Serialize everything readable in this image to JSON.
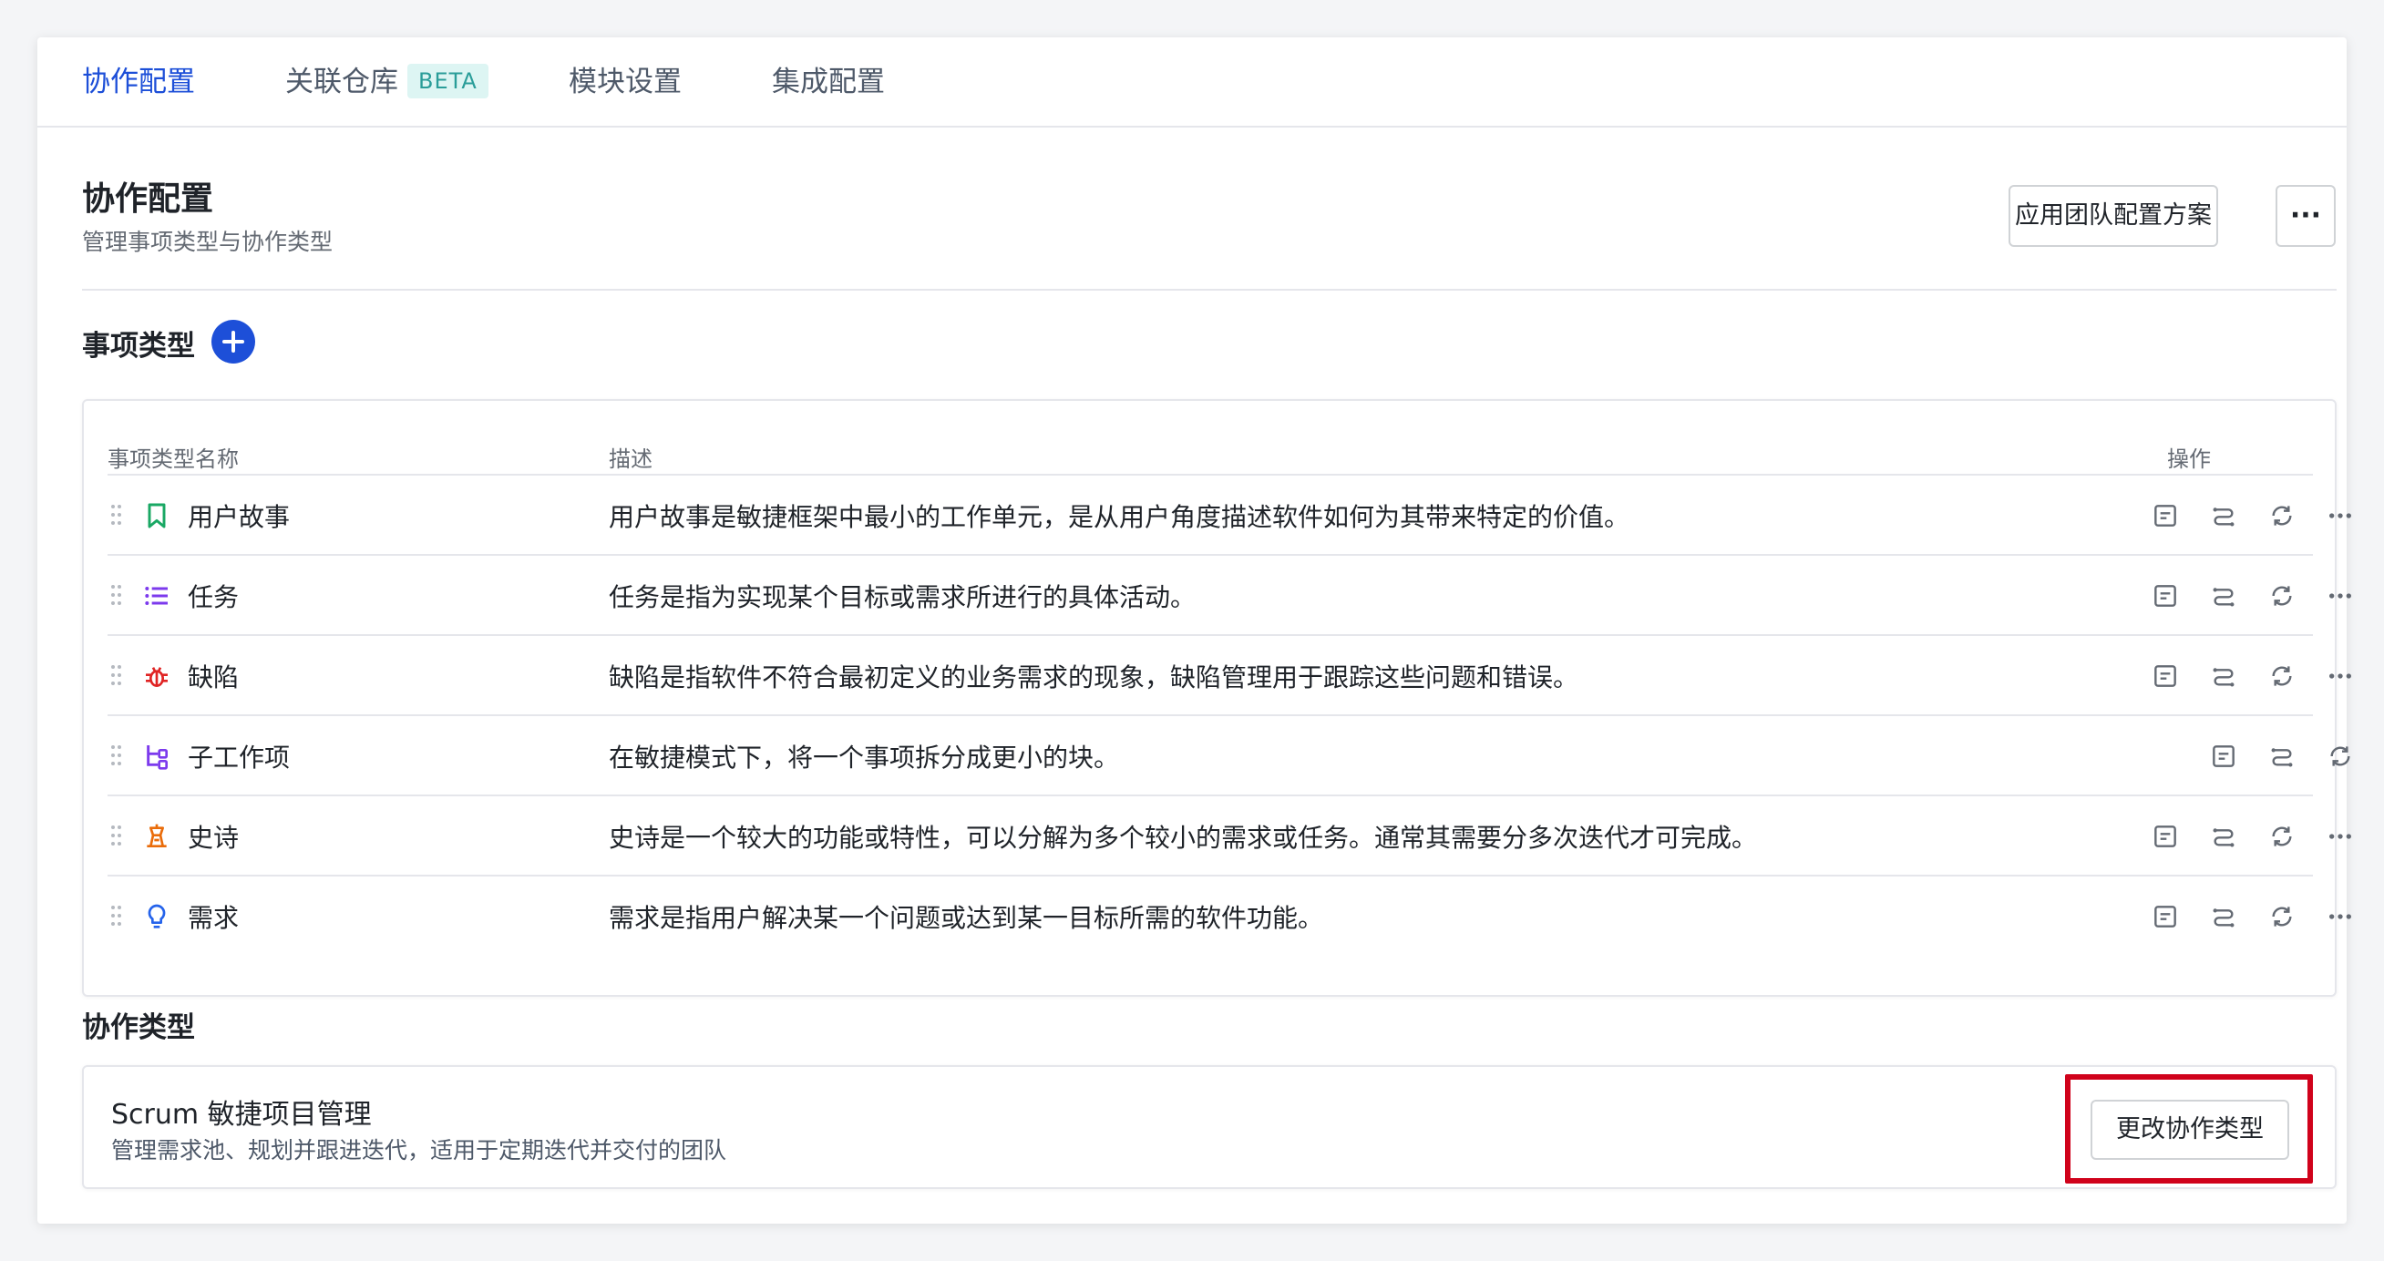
{
  "tabs": [
    {
      "label": "协作配置",
      "active": true
    },
    {
      "label": "关联仓库",
      "badge": "BETA"
    },
    {
      "label": "模块设置"
    },
    {
      "label": "集成配置"
    }
  ],
  "header": {
    "title": "协作配置",
    "subtitle": "管理事项类型与协作类型",
    "apply_button": "应用团队配置方案",
    "more_button": "···"
  },
  "issue_types": {
    "section_title": "事项类型",
    "columns": {
      "name": "事项类型名称",
      "description": "描述",
      "actions": "操作"
    },
    "rows": [
      {
        "icon": "bookmark-icon",
        "color": "#1aa864",
        "name": "用户故事",
        "description": "用户故事是敏捷框架中最小的工作单元，是从用户角度描述软件如何为其带来特定的价值。",
        "has_more": true
      },
      {
        "icon": "list-icon",
        "color": "#7c3aed",
        "name": "任务",
        "description": "任务是指为实现某个目标或需求所进行的具体活动。",
        "has_more": true
      },
      {
        "icon": "bug-icon",
        "color": "#e02424",
        "name": "缺陷",
        "description": "缺陷是指软件不符合最初定义的业务需求的现象，缺陷管理用于跟踪这些问题和错误。",
        "has_more": true
      },
      {
        "icon": "subtask-icon",
        "color": "#7c3aed",
        "name": "子工作项",
        "description": "在敏捷模式下，将一个事项拆分成更小的块。",
        "has_more": false
      },
      {
        "icon": "epic-icon",
        "color": "#ea6c0a",
        "name": "史诗",
        "description": "史诗是一个较大的功能或特性，可以分解为多个较小的需求或任务。通常其需要分多次迭代才可完成。",
        "has_more": true
      },
      {
        "icon": "lightbulb-icon",
        "color": "#2563eb",
        "name": "需求",
        "description": "需求是指用户解决某一个问题或达到某一目标所需的软件功能。",
        "has_more": true
      }
    ]
  },
  "collab_types": {
    "section_title": "协作类型",
    "current_name": "Scrum 敏捷项目管理",
    "current_desc": "管理需求池、规划并跟进迭代，适用于定期迭代并交付的团队",
    "change_button": "更改协作类型"
  },
  "colors": {
    "accent": "#1d4fd8",
    "highlight": "#d0021b"
  }
}
